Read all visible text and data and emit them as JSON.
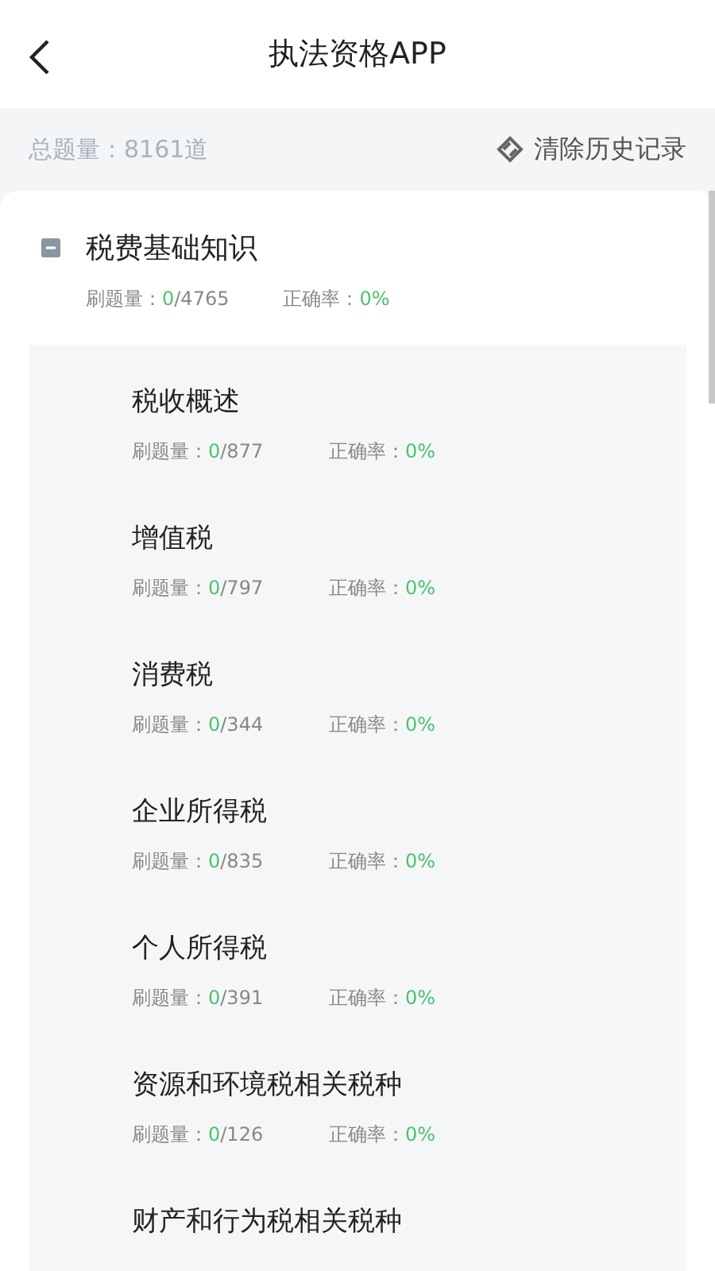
{
  "header": {
    "title": "执法资格APP"
  },
  "summary": {
    "label": "总题量：",
    "count": "8161道",
    "clear_button": "清除历史记录"
  },
  "section": {
    "title": "税费基础知识",
    "expanded": true,
    "done_label": "刷题量：",
    "done": "0",
    "total": "/4765",
    "rate_label": "正确率：",
    "rate": "0%",
    "children": [
      {
        "title": "税收概述",
        "done_label": "刷题量：",
        "done": "0",
        "total": "/877",
        "rate_label": "正确率：",
        "rate": "0%"
      },
      {
        "title": "增值税",
        "done_label": "刷题量：",
        "done": "0",
        "total": "/797",
        "rate_label": "正确率：",
        "rate": "0%"
      },
      {
        "title": "消费税",
        "done_label": "刷题量：",
        "done": "0",
        "total": "/344",
        "rate_label": "正确率：",
        "rate": "0%"
      },
      {
        "title": "企业所得税",
        "done_label": "刷题量：",
        "done": "0",
        "total": "/835",
        "rate_label": "正确率：",
        "rate": "0%"
      },
      {
        "title": "个人所得税",
        "done_label": "刷题量：",
        "done": "0",
        "total": "/391",
        "rate_label": "正确率：",
        "rate": "0%"
      },
      {
        "title": "资源和环境税相关税种",
        "done_label": "刷题量：",
        "done": "0",
        "total": "/126",
        "rate_label": "正确率：",
        "rate": "0%"
      },
      {
        "title": "财产和行为税相关税种"
      }
    ]
  }
}
